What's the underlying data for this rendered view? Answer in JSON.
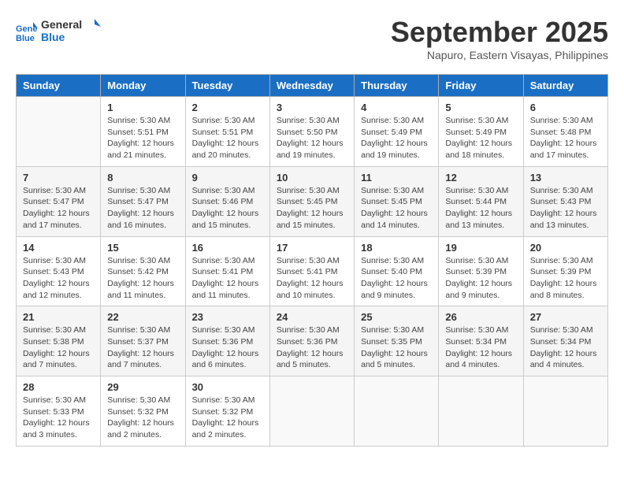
{
  "header": {
    "logo_line1": "General",
    "logo_line2": "Blue",
    "month": "September 2025",
    "location": "Napuro, Eastern Visayas, Philippines"
  },
  "days_of_week": [
    "Sunday",
    "Monday",
    "Tuesday",
    "Wednesday",
    "Thursday",
    "Friday",
    "Saturday"
  ],
  "weeks": [
    [
      {
        "day": "",
        "text": ""
      },
      {
        "day": "1",
        "text": "Sunrise: 5:30 AM\nSunset: 5:51 PM\nDaylight: 12 hours\nand 21 minutes."
      },
      {
        "day": "2",
        "text": "Sunrise: 5:30 AM\nSunset: 5:51 PM\nDaylight: 12 hours\nand 20 minutes."
      },
      {
        "day": "3",
        "text": "Sunrise: 5:30 AM\nSunset: 5:50 PM\nDaylight: 12 hours\nand 19 minutes."
      },
      {
        "day": "4",
        "text": "Sunrise: 5:30 AM\nSunset: 5:49 PM\nDaylight: 12 hours\nand 19 minutes."
      },
      {
        "day": "5",
        "text": "Sunrise: 5:30 AM\nSunset: 5:49 PM\nDaylight: 12 hours\nand 18 minutes."
      },
      {
        "day": "6",
        "text": "Sunrise: 5:30 AM\nSunset: 5:48 PM\nDaylight: 12 hours\nand 17 minutes."
      }
    ],
    [
      {
        "day": "7",
        "text": "Sunrise: 5:30 AM\nSunset: 5:47 PM\nDaylight: 12 hours\nand 17 minutes."
      },
      {
        "day": "8",
        "text": "Sunrise: 5:30 AM\nSunset: 5:47 PM\nDaylight: 12 hours\nand 16 minutes."
      },
      {
        "day": "9",
        "text": "Sunrise: 5:30 AM\nSunset: 5:46 PM\nDaylight: 12 hours\nand 15 minutes."
      },
      {
        "day": "10",
        "text": "Sunrise: 5:30 AM\nSunset: 5:45 PM\nDaylight: 12 hours\nand 15 minutes."
      },
      {
        "day": "11",
        "text": "Sunrise: 5:30 AM\nSunset: 5:45 PM\nDaylight: 12 hours\nand 14 minutes."
      },
      {
        "day": "12",
        "text": "Sunrise: 5:30 AM\nSunset: 5:44 PM\nDaylight: 12 hours\nand 13 minutes."
      },
      {
        "day": "13",
        "text": "Sunrise: 5:30 AM\nSunset: 5:43 PM\nDaylight: 12 hours\nand 13 minutes."
      }
    ],
    [
      {
        "day": "14",
        "text": "Sunrise: 5:30 AM\nSunset: 5:43 PM\nDaylight: 12 hours\nand 12 minutes."
      },
      {
        "day": "15",
        "text": "Sunrise: 5:30 AM\nSunset: 5:42 PM\nDaylight: 12 hours\nand 11 minutes."
      },
      {
        "day": "16",
        "text": "Sunrise: 5:30 AM\nSunset: 5:41 PM\nDaylight: 12 hours\nand 11 minutes."
      },
      {
        "day": "17",
        "text": "Sunrise: 5:30 AM\nSunset: 5:41 PM\nDaylight: 12 hours\nand 10 minutes."
      },
      {
        "day": "18",
        "text": "Sunrise: 5:30 AM\nSunset: 5:40 PM\nDaylight: 12 hours\nand 9 minutes."
      },
      {
        "day": "19",
        "text": "Sunrise: 5:30 AM\nSunset: 5:39 PM\nDaylight: 12 hours\nand 9 minutes."
      },
      {
        "day": "20",
        "text": "Sunrise: 5:30 AM\nSunset: 5:39 PM\nDaylight: 12 hours\nand 8 minutes."
      }
    ],
    [
      {
        "day": "21",
        "text": "Sunrise: 5:30 AM\nSunset: 5:38 PM\nDaylight: 12 hours\nand 7 minutes."
      },
      {
        "day": "22",
        "text": "Sunrise: 5:30 AM\nSunset: 5:37 PM\nDaylight: 12 hours\nand 7 minutes."
      },
      {
        "day": "23",
        "text": "Sunrise: 5:30 AM\nSunset: 5:36 PM\nDaylight: 12 hours\nand 6 minutes."
      },
      {
        "day": "24",
        "text": "Sunrise: 5:30 AM\nSunset: 5:36 PM\nDaylight: 12 hours\nand 5 minutes."
      },
      {
        "day": "25",
        "text": "Sunrise: 5:30 AM\nSunset: 5:35 PM\nDaylight: 12 hours\nand 5 minutes."
      },
      {
        "day": "26",
        "text": "Sunrise: 5:30 AM\nSunset: 5:34 PM\nDaylight: 12 hours\nand 4 minutes."
      },
      {
        "day": "27",
        "text": "Sunrise: 5:30 AM\nSunset: 5:34 PM\nDaylight: 12 hours\nand 4 minutes."
      }
    ],
    [
      {
        "day": "28",
        "text": "Sunrise: 5:30 AM\nSunset: 5:33 PM\nDaylight: 12 hours\nand 3 minutes."
      },
      {
        "day": "29",
        "text": "Sunrise: 5:30 AM\nSunset: 5:32 PM\nDaylight: 12 hours\nand 2 minutes."
      },
      {
        "day": "30",
        "text": "Sunrise: 5:30 AM\nSunset: 5:32 PM\nDaylight: 12 hours\nand 2 minutes."
      },
      {
        "day": "",
        "text": ""
      },
      {
        "day": "",
        "text": ""
      },
      {
        "day": "",
        "text": ""
      },
      {
        "day": "",
        "text": ""
      }
    ]
  ]
}
